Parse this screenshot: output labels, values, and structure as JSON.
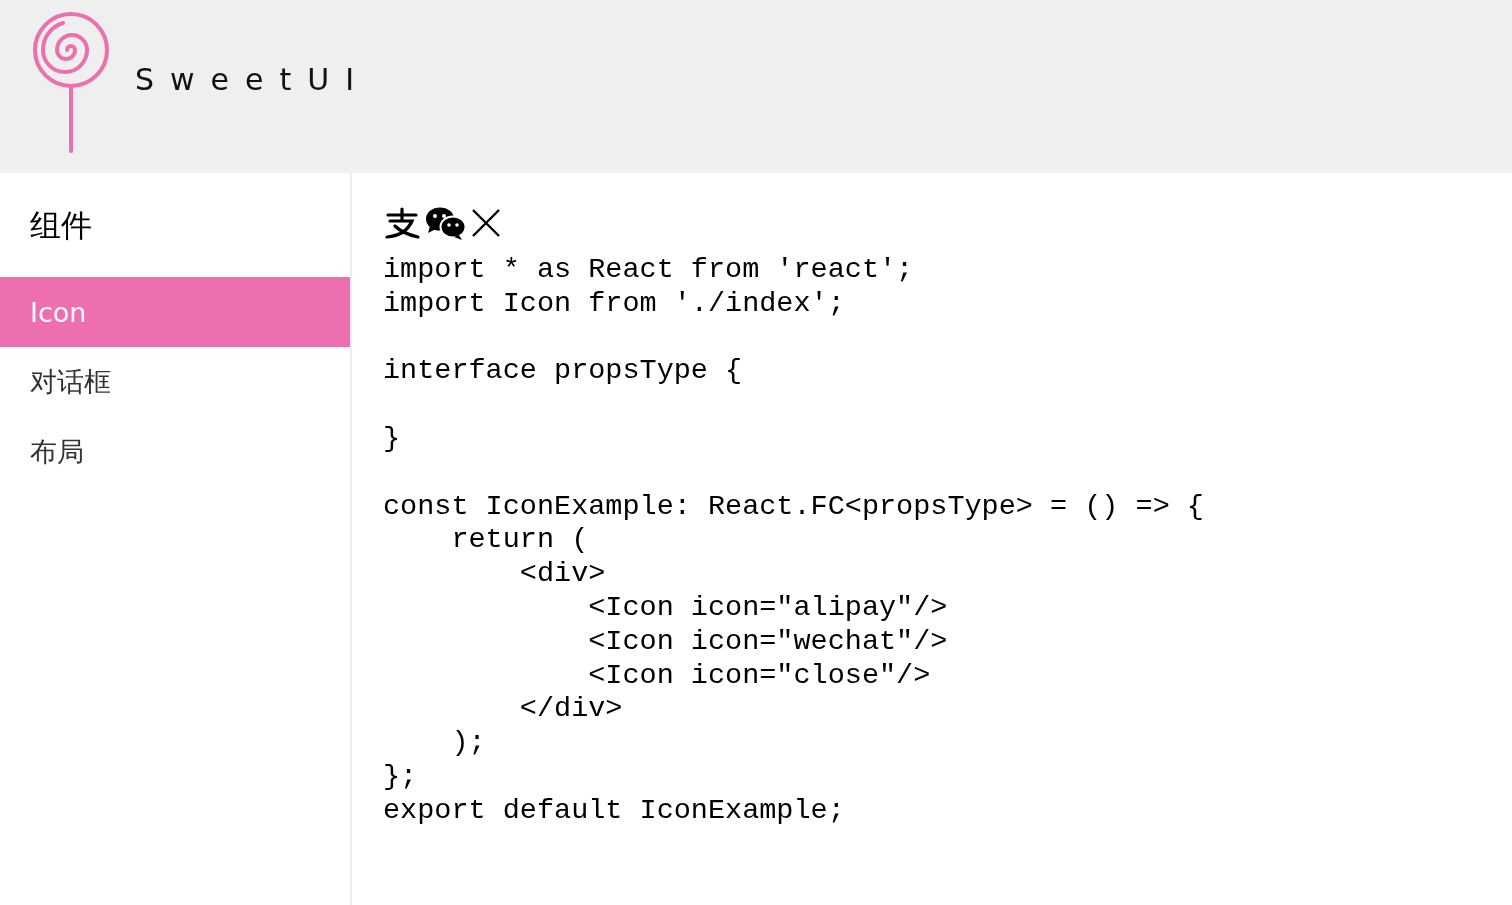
{
  "header": {
    "logo_text": "SweetUI"
  },
  "sidebar": {
    "title": "组件",
    "items": [
      {
        "label": "Icon",
        "selected": true
      },
      {
        "label": "对话框",
        "selected": false
      },
      {
        "label": "布局",
        "selected": false
      }
    ]
  },
  "content": {
    "icons": [
      {
        "kind": "alipay"
      },
      {
        "kind": "wechat"
      },
      {
        "kind": "close"
      }
    ],
    "code_blocks": [
      [
        "import * as React from 'react';",
        "import Icon from './index';"
      ],
      [
        "interface propsType {"
      ],
      [
        "}"
      ],
      [
        "const IconExample: React.FC<propsType> = () => {",
        "    return (",
        "        <div>",
        "            <Icon icon=\"alipay\"/>",
        "            <Icon icon=\"wechat\"/>",
        "            <Icon icon=\"close\"/>",
        "        </div>",
        "    );",
        "};",
        "export default IconExample;"
      ]
    ]
  }
}
